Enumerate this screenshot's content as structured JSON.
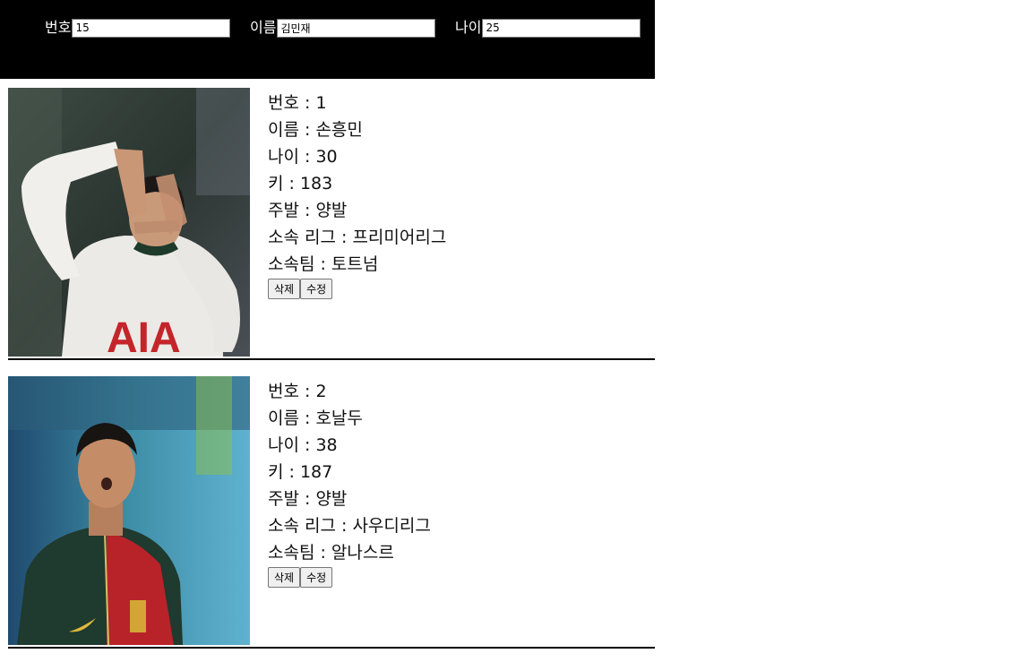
{
  "form": {
    "number": {
      "label": "번호",
      "value": "15"
    },
    "name": {
      "label": "이름",
      "value": "김민재"
    },
    "age": {
      "label": "나이",
      "value": "25"
    }
  },
  "players": [
    {
      "photo_icon": "player-photo",
      "lines": {
        "number": "번호 : 1",
        "name": "이름 : 손흥민",
        "age": "나이 : 30",
        "height": "키 : 183",
        "foot": "주발 : 양발",
        "league": "소속 리그 : 프리미어리그",
        "team": "소속팀 : 토트넘"
      },
      "delete_label": "삭제",
      "edit_label": "수정"
    },
    {
      "photo_icon": "player-photo",
      "lines": {
        "number": "번호 : 2",
        "name": "이름 : 호날두",
        "age": "나이 : 38",
        "height": "키 : 187",
        "foot": "주발 : 양발",
        "league": "소속 리그 : 사우디리그",
        "team": "소속팀 : 알나스르"
      },
      "delete_label": "삭제",
      "edit_label": "수정"
    }
  ]
}
